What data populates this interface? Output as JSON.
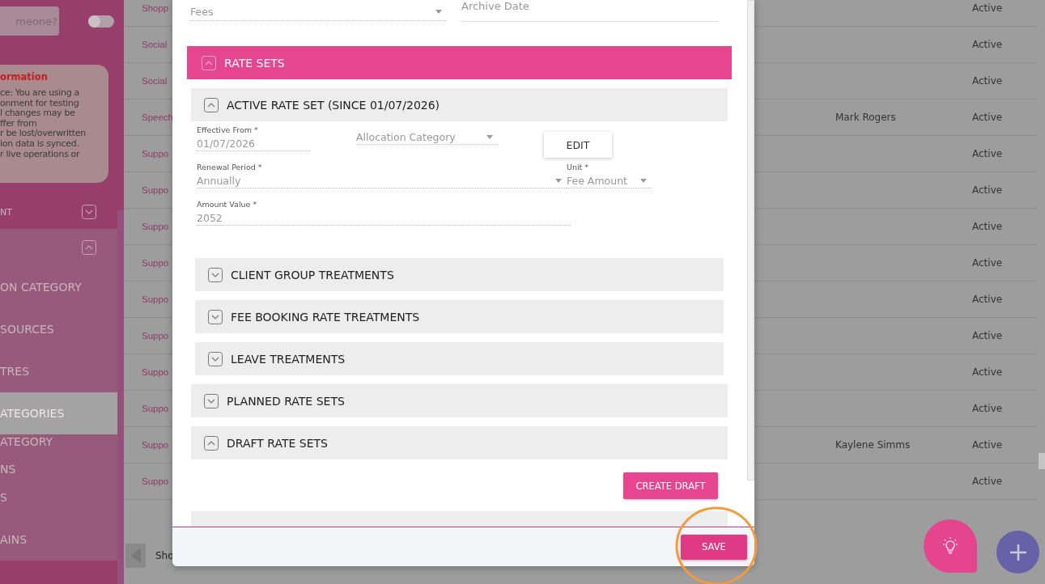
{
  "sidebar": {
    "search": {
      "placeholder": "meone?"
    },
    "toggle": {
      "on": false
    },
    "info": {
      "title": "ormation",
      "text": "ce: You are using a\nonment for testing\nl changes may be\nffer from\nr be lost/overwritten\nion data is synced.\nr live operations or"
    },
    "sections": [
      {
        "label": "NT",
        "expanded": false
      },
      {
        "expanded": true,
        "items": [
          {
            "label": "ON CATEGORY",
            "selected": false
          },
          {
            "label": "SOURCES",
            "selected": false
          },
          {
            "label": "TRES",
            "selected": false
          },
          {
            "label": "ATEGORIES",
            "selected": true
          },
          {
            "label": "ATEGORY\nNS",
            "selected": false
          },
          {
            "label": "S",
            "selected": false
          },
          {
            "label": "AINS",
            "selected": false
          }
        ]
      }
    ]
  },
  "table": {
    "rows": [
      {
        "name": "Shopp",
        "status": "Active"
      },
      {
        "name": "Social",
        "status": "Active"
      },
      {
        "name": "Social",
        "status": "Active"
      },
      {
        "name": "Speech",
        "assignee": "Mark Rogers",
        "status": "Active"
      },
      {
        "name": "Suppo",
        "status": "Active"
      },
      {
        "name": "Suppo",
        "status": "Active"
      },
      {
        "name": "Suppo",
        "status": "Active"
      },
      {
        "name": "Suppo",
        "status": "Active"
      },
      {
        "name": "Suppo",
        "status": "Active"
      },
      {
        "name": "Suppo",
        "status": "Active"
      },
      {
        "name": "Suppo",
        "status": "Active"
      },
      {
        "name": "Suppo",
        "status": "Active"
      },
      {
        "name": "Suppo",
        "assignee": "Kaylene Simms",
        "status": "Active"
      },
      {
        "name": "Suppo",
        "status": "Active"
      }
    ],
    "pagination": {
      "show_label": "Sho"
    }
  },
  "modal": {
    "type_field": {
      "value": "Fees"
    },
    "archive_date": {
      "placeholder": "Archive Date"
    },
    "rate_sets": {
      "title": "RATE SETS",
      "expanded": true,
      "active": {
        "title": "ACTIVE RATE SET (SINCE 01/07/2026)",
        "expanded": true,
        "fields": [
          {
            "kind": "text",
            "label": "Effective From *",
            "value": "01/07/2026"
          },
          {
            "kind": "select",
            "placeholder": "Allocation Category"
          },
          {
            "kind": "button",
            "label": "EDIT"
          },
          {
            "kind": "select",
            "label": "Renewal Period *",
            "value": "Annually"
          },
          {
            "kind": "select",
            "label": "Unit *",
            "value": "Fee Amount"
          },
          {
            "kind": "text",
            "label": "Amount Value *",
            "value": "2052"
          }
        ],
        "subsections": [
          {
            "title": "CLIENT GROUP TREATMENTS",
            "expanded": false
          },
          {
            "title": "FEE BOOKING RATE TREATMENTS",
            "expanded": false
          },
          {
            "title": "LEAVE TREATMENTS",
            "expanded": false
          }
        ]
      },
      "groups": [
        {
          "title": "PLANNED RATE SETS",
          "expanded": false
        },
        {
          "title": "DRAFT RATE SETS",
          "expanded": true
        }
      ],
      "create_draft": "CREATE DRAFT"
    },
    "save": "SAVE"
  }
}
